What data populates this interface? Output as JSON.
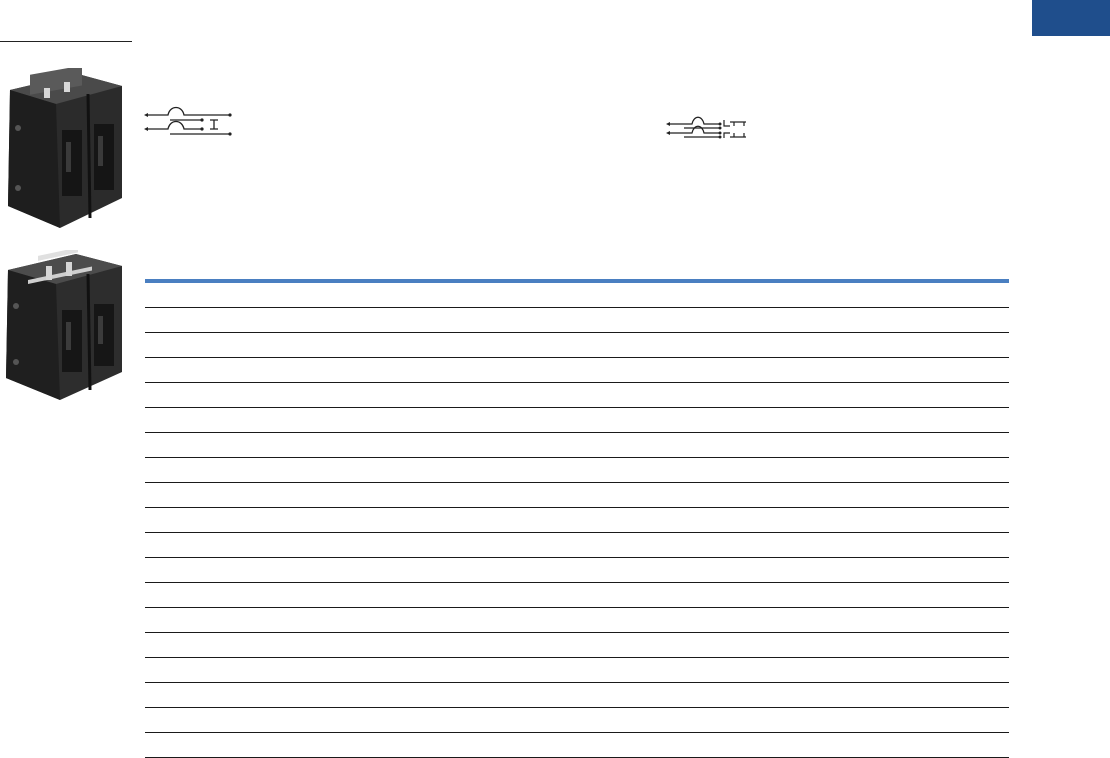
{
  "page": {
    "section_tab_color": "#1f4e8c",
    "table_header_rule_color": "#4a7fc1",
    "row_line_color": "#1a1a1a"
  },
  "products": [
    {
      "icon": "quadplex-breaker-photo-icon"
    },
    {
      "icon": "quadplex-breaker-with-handle-tie-photo-icon"
    }
  ],
  "wiring_diagrams": [
    {
      "icon": "two-pole-tandem-wiring-diagram-icon"
    },
    {
      "icon": "quadplex-wiring-diagram-icon"
    }
  ],
  "table": {
    "row_count": 19,
    "rows": []
  }
}
